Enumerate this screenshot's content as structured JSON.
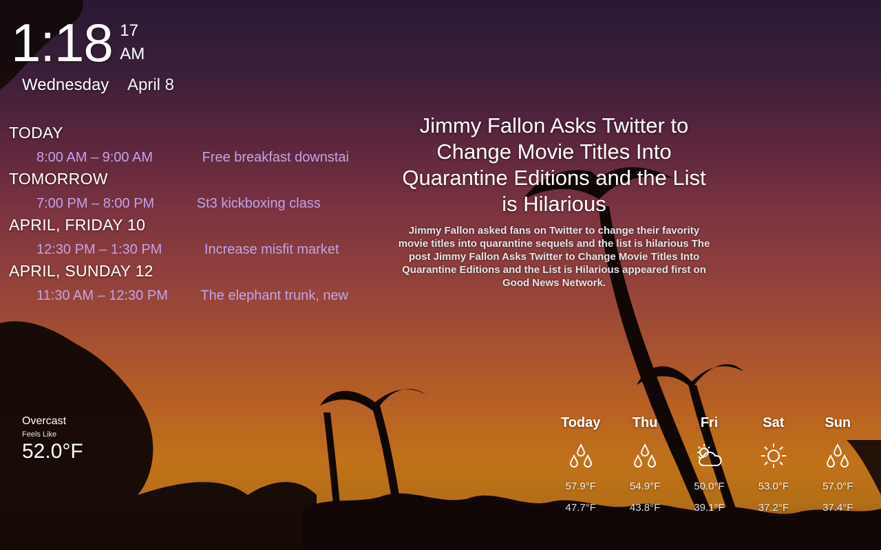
{
  "clock": {
    "time": "1:18",
    "seconds": "17",
    "ampm": "AM"
  },
  "date": {
    "weekday": "Wednesday",
    "month_day": "April 8"
  },
  "calendar": {
    "groups": [
      {
        "header": "TODAY",
        "events": [
          {
            "time": "8:00 AM – 9:00 AM",
            "title": "Free breakfast downstairs"
          }
        ]
      },
      {
        "header": "TOMORROW",
        "events": [
          {
            "time": "7:00 PM – 8:00 PM",
            "title": "St3 kickboxing class"
          }
        ]
      },
      {
        "header": "APRIL, FRIDAY 10",
        "events": [
          {
            "time": "12:30 PM – 1:30 PM",
            "title": "Increase misfit market"
          }
        ]
      },
      {
        "header": "APRIL, SUNDAY 12",
        "events": [
          {
            "time": "11:30 AM – 12:30 PM",
            "title": "The elephant trunk, new"
          }
        ]
      }
    ]
  },
  "news": {
    "headline": "Jimmy Fallon Asks Twitter to Change Movie Titles Into Quarantine Editions and the List is Hilarious",
    "body": "Jimmy Fallon asked fans on Twitter to change their favority movie titles into quarantine sequels and the list is hilarious The post Jimmy Fallon Asks Twitter to Change Movie Titles Into Quarantine Editions and the List is Hilarious appeared first on Good News Network."
  },
  "weather": {
    "current": {
      "condition": "Overcast",
      "feels_like_label": "Feels Like",
      "temp": "52.0°F"
    },
    "forecast": [
      {
        "day": "Today",
        "icon": "rain-drops-icon",
        "high": "57.9°F",
        "low": "47.7°F"
      },
      {
        "day": "Thu",
        "icon": "rain-drops-icon",
        "high": "54.9°F",
        "low": "43.8°F"
      },
      {
        "day": "Fri",
        "icon": "partly-cloudy-icon",
        "high": "50.0°F",
        "low": "39.1°F"
      },
      {
        "day": "Sat",
        "icon": "sun-icon",
        "high": "53.0°F",
        "low": "37.2°F"
      },
      {
        "day": "Sun",
        "icon": "rain-drops-icon",
        "high": "57.0°F",
        "low": "37.4°F"
      }
    ]
  },
  "colors": {
    "event_text": "#c2a3e8",
    "sky_top": "#2c1c3a",
    "sky_bottom": "#d27c1c"
  }
}
